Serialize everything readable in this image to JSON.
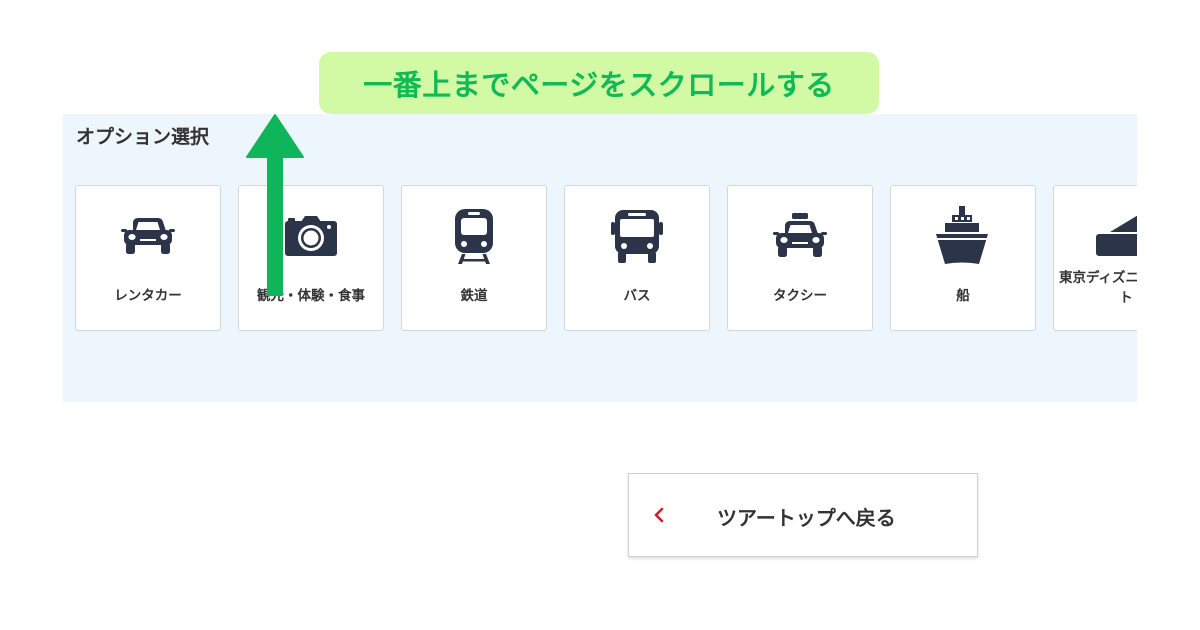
{
  "hint": {
    "text": "一番上までページをスクロールする"
  },
  "options": {
    "title": "オプション選択",
    "items": [
      {
        "label": "レンタカー",
        "icon": "car-icon"
      },
      {
        "label": "観光・体験・食事",
        "icon": "camera-icon"
      },
      {
        "label": "鉄道",
        "icon": "train-icon"
      },
      {
        "label": "バス",
        "icon": "bus-icon"
      },
      {
        "label": "タクシー",
        "icon": "taxi-icon"
      },
      {
        "label": "船",
        "icon": "ship-icon"
      },
      {
        "label": "東京ディズニーリゾート",
        "icon": "ticket-icon"
      }
    ]
  },
  "footer": {
    "back_label": "ツアートップへ戻る"
  },
  "colors": {
    "icon": "#2b3448",
    "panel_bg": "#eef6fd",
    "hint_bg": "#d2f9a3",
    "hint_text": "#11b957",
    "arrow": "#0fb55a",
    "chevron": "#cc1f2d"
  }
}
